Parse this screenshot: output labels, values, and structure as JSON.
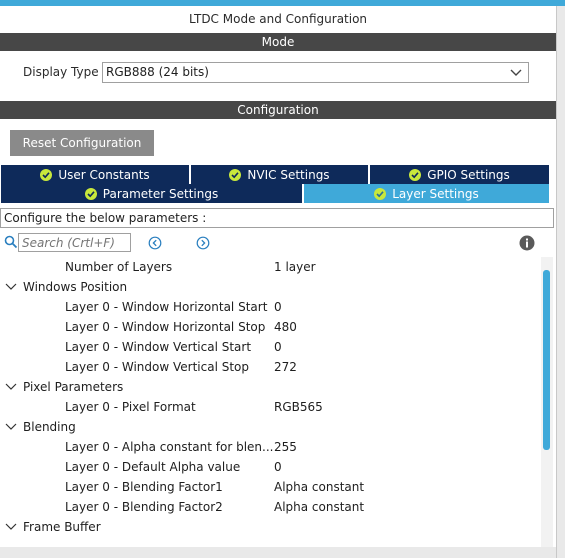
{
  "window": {
    "title": "LTDC Mode and Configuration"
  },
  "mode": {
    "header": "Mode",
    "display_type_label": "Display Type",
    "display_type_value": "RGB888 (24 bits)"
  },
  "configuration": {
    "header": "Configuration",
    "reset_label": "Reset Configuration",
    "tabs_row1": [
      {
        "label": "User Constants"
      },
      {
        "label": "NVIC Settings"
      },
      {
        "label": "GPIO Settings"
      }
    ],
    "tabs_row2": [
      {
        "label": "Parameter Settings"
      },
      {
        "label": "Layer Settings",
        "active": true
      }
    ],
    "prompt": "Configure the below parameters :",
    "search_placeholder": "Search (Crtl+F)"
  },
  "tree": {
    "number_of_layers": {
      "name": "Number of Layers",
      "value": "1 layer"
    },
    "groups": [
      {
        "label": "Windows Position",
        "params": [
          {
            "name": "Layer 0 - Window Horizontal Start",
            "value": "0"
          },
          {
            "name": "Layer 0 - Window Horizontal Stop",
            "value": "480"
          },
          {
            "name": "Layer 0 - Window Vertical Start",
            "value": "0"
          },
          {
            "name": "Layer 0 - Window Vertical Stop",
            "value": "272"
          }
        ]
      },
      {
        "label": "Pixel Parameters",
        "params": [
          {
            "name": "Layer 0 - Pixel Format",
            "value": "RGB565"
          }
        ]
      },
      {
        "label": "Blending",
        "params": [
          {
            "name": "Layer 0 - Alpha constant for blen...",
            "value": "255"
          },
          {
            "name": "Layer 0 - Default Alpha value",
            "value": "0"
          },
          {
            "name": "Layer 0 - Blending Factor1",
            "value": "Alpha constant"
          },
          {
            "name": "Layer 0 - Blending Factor2",
            "value": "Alpha constant"
          }
        ]
      },
      {
        "label": "Frame Buffer",
        "params": []
      }
    ]
  },
  "colors": {
    "accent": "#3fa9d9",
    "tab_dark": "#0e2a5a",
    "section_header": "#474747",
    "check_green": "#c8e83c"
  },
  "icons": {
    "search": "search-icon",
    "prev": "previous-arrow-icon",
    "next": "next-arrow-icon",
    "info": "info-icon",
    "check": "check-icon",
    "chevron": "chevron-down-icon"
  }
}
